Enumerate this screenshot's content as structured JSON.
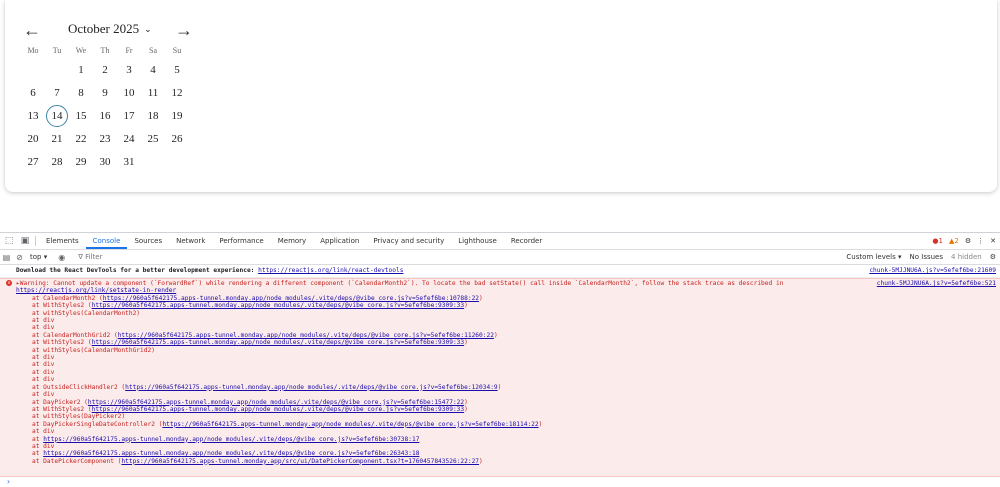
{
  "calendar": {
    "prev_icon": "arrow-left-icon",
    "next_icon": "arrow-right-icon",
    "month_label": "October 2025",
    "weekdays": [
      "Mo",
      "Tu",
      "We",
      "Th",
      "Fr",
      "Sa",
      "Su"
    ],
    "leading_blanks": 2,
    "days": [
      "1",
      "2",
      "3",
      "4",
      "5",
      "6",
      "7",
      "8",
      "9",
      "10",
      "11",
      "12",
      "13",
      "14",
      "15",
      "16",
      "17",
      "18",
      "19",
      "20",
      "21",
      "22",
      "23",
      "24",
      "25",
      "26",
      "27",
      "28",
      "29",
      "30",
      "31"
    ],
    "today": "14",
    "today_color": "#3d84a8"
  },
  "devtools": {
    "tabs": [
      "Elements",
      "Console",
      "Sources",
      "Network",
      "Performance",
      "Memory",
      "Application",
      "Privacy and security",
      "Lighthouse",
      "Recorder"
    ],
    "active_tab": "Console",
    "error_count": "1",
    "warning_count": "2",
    "toolbar": {
      "context": "top",
      "filter_placeholder": "Filter",
      "levels": "Custom levels",
      "issues": "No Issues",
      "hidden": "4 hidden"
    },
    "info_message": {
      "text": "Download the React DevTools for a better development experience: ",
      "link": "https://reactjs.org/link/react-devtools",
      "source": "chunk-5MJJNU6A.js?v=5efef6be:21609"
    },
    "warning": {
      "text": "▸Warning: Cannot update a component (`ForwardRef`) while rendering a different component (`CalendarMonth2`). To locate the bad setState() call inside `CalendarMonth2`, follow the stack trace as described in",
      "link": "https://reactjs.org/link/setstate-in-render",
      "source": "chunk-5MJJNU6A.js?v=5efef6be:521",
      "stack": [
        {
          "prefix": "at CalendarMonth2 (",
          "link": "https://960a5f642175.apps-tunnel.monday.app/node_modules/.vite/deps/@vibe_core.js?v=5efef6be:10788:22",
          "suffix": ")"
        },
        {
          "prefix": "at WithStyles2 (",
          "link": "https://960a5f642175.apps-tunnel.monday.app/node_modules/.vite/deps/@vibe_core.js?v=5efef6be:9309:33",
          "suffix": ")"
        },
        {
          "prefix": "at withStyles(CalendarMonth2)",
          "link": "",
          "suffix": ""
        },
        {
          "prefix": "at div",
          "link": "",
          "suffix": ""
        },
        {
          "prefix": "at div",
          "link": "",
          "suffix": ""
        },
        {
          "prefix": "at CalendarMonthGrid2 (",
          "link": "https://960a5f642175.apps-tunnel.monday.app/node_modules/.vite/deps/@vibe_core.js?v=5efef6be:11260:22",
          "suffix": ")"
        },
        {
          "prefix": "at WithStyles2 (",
          "link": "https://960a5f642175.apps-tunnel.monday.app/node_modules/.vite/deps/@vibe_core.js?v=5efef6be:9309:33",
          "suffix": ")"
        },
        {
          "prefix": "at withStyles(CalendarMonthGrid2)",
          "link": "",
          "suffix": ""
        },
        {
          "prefix": "at div",
          "link": "",
          "suffix": ""
        },
        {
          "prefix": "at div",
          "link": "",
          "suffix": ""
        },
        {
          "prefix": "at div",
          "link": "",
          "suffix": ""
        },
        {
          "prefix": "at div",
          "link": "",
          "suffix": ""
        },
        {
          "prefix": "at OutsideClickHandler2 (",
          "link": "https://960a5f642175.apps-tunnel.monday.app/node_modules/.vite/deps/@vibe_core.js?v=5efef6be:12034:9",
          "suffix": ")"
        },
        {
          "prefix": "at div",
          "link": "",
          "suffix": ""
        },
        {
          "prefix": "at DayPicker2 (",
          "link": "https://960a5f642175.apps-tunnel.monday.app/node_modules/.vite/deps/@vibe_core.js?v=5efef6be:15477:22",
          "suffix": ")"
        },
        {
          "prefix": "at WithStyles2 (",
          "link": "https://960a5f642175.apps-tunnel.monday.app/node_modules/.vite/deps/@vibe_core.js?v=5efef6be:9309:33",
          "suffix": ")"
        },
        {
          "prefix": "at withStyles(DayPicker2)",
          "link": "",
          "suffix": ""
        },
        {
          "prefix": "at DayPickerSingleDateController2 (",
          "link": "https://960a5f642175.apps-tunnel.monday.app/node_modules/.vite/deps/@vibe_core.js?v=5efef6be:18114:22",
          "suffix": ")"
        },
        {
          "prefix": "at div",
          "link": "",
          "suffix": ""
        },
        {
          "prefix": "at ",
          "link": "https://960a5f642175.apps-tunnel.monday.app/node_modules/.vite/deps/@vibe_core.js?v=5efef6be:30738:17",
          "suffix": ""
        },
        {
          "prefix": "at div",
          "link": "",
          "suffix": ""
        },
        {
          "prefix": "at ",
          "link": "https://960a5f642175.apps-tunnel.monday.app/node_modules/.vite/deps/@vibe_core.js?v=5efef6be:26343:18",
          "suffix": ""
        },
        {
          "prefix": "at DatePickerComponent (",
          "link": "https://960a5f642175.apps-tunnel.monday.app/src/ui/DatePickerComponent.tsx?t=1760457843526:22:27",
          "suffix": ")"
        }
      ]
    }
  }
}
